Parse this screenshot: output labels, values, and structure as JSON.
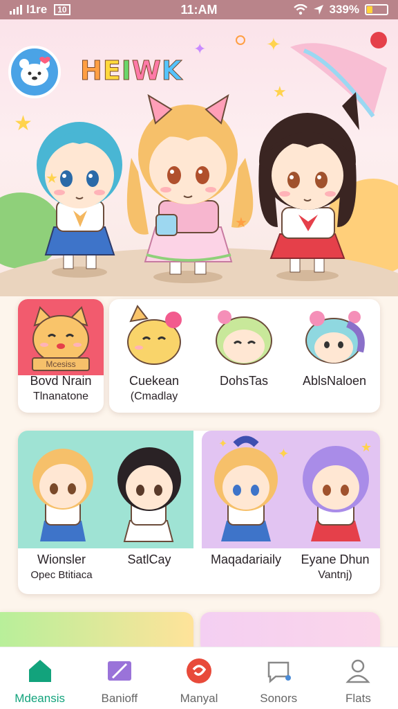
{
  "status_bar": {
    "carrier": "ll ll",
    "net_label": "l1re",
    "badge": "10",
    "time": "11:AM",
    "battery_percent": "339%"
  },
  "header": {
    "logo_text": "HEIWK"
  },
  "row1": {
    "featured": {
      "badge": "Mcesiss",
      "title": "Bovd Nrain",
      "subtitle": "Tlnanatone"
    },
    "items": [
      {
        "title": "Cuekean",
        "subtitle": "(Cmadlay"
      },
      {
        "title": "DohsTas",
        "subtitle": ""
      },
      {
        "title": "AblsNaloen",
        "subtitle": ""
      }
    ]
  },
  "row2": {
    "left_items": [
      {
        "title": "Wionsler",
        "subtitle": "Opec Btitiaca"
      },
      {
        "title": "SatlCay",
        "subtitle": ""
      }
    ],
    "right_items": [
      {
        "title": "Maqadariaily",
        "subtitle": ""
      },
      {
        "title": "Eyane Dhun",
        "subtitle": "Vantnj)"
      }
    ]
  },
  "nav": {
    "tabs": [
      {
        "label": "Mdeansis",
        "icon": "home-icon"
      },
      {
        "label": "Banioff",
        "icon": "cards-icon"
      },
      {
        "label": "Manyal",
        "icon": "swirl-icon"
      },
      {
        "label": "Sonors",
        "icon": "chat-icon"
      },
      {
        "label": "Flats",
        "icon": "profile-icon"
      }
    ],
    "active_index": 0
  },
  "colors": {
    "accent": "#12a37c",
    "status_bar": "#b9848a",
    "background": "#fdf5ec"
  }
}
